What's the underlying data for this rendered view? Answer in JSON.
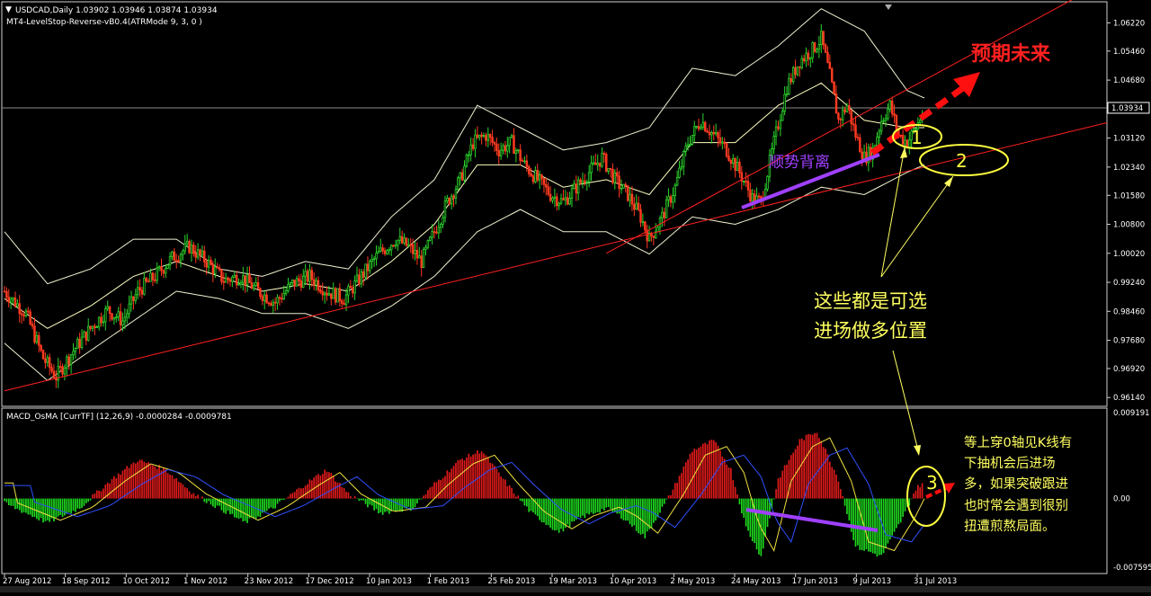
{
  "chart_data": [
    {
      "type": "candlestick",
      "symbol_header": "USDCAD,Daily  1.03902 1.03946 1.03874 1.03934",
      "indicator_header": "MT4-LevelStop-Reverse-vB0.4(ATRMode 9, 3, 0 )",
      "ylim": [
        0.96,
        1.064
      ],
      "y_ticks": [
        "1.06220",
        "1.05460",
        "1.04680",
        "1.03934",
        "1.03120",
        "1.02340",
        "1.01580",
        "1.00800",
        "1.00020",
        "0.99240",
        "0.98460",
        "0.97680",
        "0.96920",
        "0.96140"
      ],
      "last_price": 1.03934,
      "x_tick_labels": [
        "27 Aug 2012",
        "18 Sep 2012",
        "10 Oct 2012",
        "1 Nov 2012",
        "23 Nov 2012",
        "17 Dec 2012",
        "10 Jan 2013",
        "1 Feb 2013",
        "25 Feb 2013",
        "19 Mar 2013",
        "10 Apr 2013",
        "2 May 2013",
        "24 May 2013",
        "17 Jun 2013",
        "9 Jul 2013",
        "31 Jul 2013"
      ],
      "close_path": [
        [
          0,
          0.99
        ],
        [
          10,
          0.984
        ],
        [
          18,
          0.972
        ],
        [
          24,
          0.967
        ],
        [
          32,
          0.974
        ],
        [
          40,
          0.98
        ],
        [
          48,
          0.985
        ],
        [
          55,
          0.982
        ],
        [
          62,
          0.99
        ],
        [
          70,
          0.994
        ],
        [
          78,
          0.999
        ],
        [
          86,
          1.002
        ],
        [
          94,
          0.998
        ],
        [
          102,
          0.993
        ],
        [
          110,
          0.994
        ],
        [
          118,
          0.99
        ],
        [
          126,
          0.987
        ],
        [
          134,
          0.992
        ],
        [
          142,
          0.994
        ],
        [
          150,
          0.99
        ],
        [
          158,
          0.988
        ],
        [
          166,
          0.994
        ],
        [
          174,
          1.0
        ],
        [
          182,
          1.004
        ],
        [
          188,
          1.002
        ],
        [
          194,
          0.998
        ],
        [
          200,
          1.006
        ],
        [
          206,
          1.014
        ],
        [
          212,
          1.02
        ],
        [
          218,
          1.03
        ],
        [
          224,
          1.032
        ],
        [
          230,
          1.028
        ],
        [
          236,
          1.03
        ],
        [
          242,
          1.024
        ],
        [
          248,
          1.02
        ],
        [
          254,
          1.016
        ],
        [
          260,
          1.014
        ],
        [
          266,
          1.018
        ],
        [
          272,
          1.022
        ],
        [
          278,
          1.026
        ],
        [
          284,
          1.02
        ],
        [
          290,
          1.016
        ],
        [
          296,
          1.01
        ],
        [
          300,
          1.004
        ],
        [
          306,
          1.01
        ],
        [
          312,
          1.018
        ],
        [
          318,
          1.03
        ],
        [
          324,
          1.036
        ],
        [
          330,
          1.032
        ],
        [
          336,
          1.028
        ],
        [
          342,
          1.022
        ],
        [
          348,
          1.015
        ],
        [
          352,
          1.014
        ],
        [
          358,
          1.03
        ],
        [
          364,
          1.045
        ],
        [
          370,
          1.052
        ],
        [
          376,
          1.055
        ],
        [
          380,
          1.058
        ],
        [
          384,
          1.048
        ],
        [
          388,
          1.036
        ],
        [
          392,
          1.04
        ],
        [
          396,
          1.032
        ],
        [
          400,
          1.026
        ],
        [
          404,
          1.028
        ],
        [
          408,
          1.036
        ],
        [
          412,
          1.04
        ],
        [
          416,
          1.032
        ],
        [
          420,
          1.03
        ],
        [
          424,
          1.034
        ],
        [
          428,
          1.039
        ]
      ],
      "bollinger": {
        "upper": [
          [
            0,
            1.006
          ],
          [
            20,
            0.992
          ],
          [
            40,
            0.996
          ],
          [
            60,
            1.004
          ],
          [
            80,
            1.004
          ],
          [
            100,
            0.996
          ],
          [
            120,
            0.994
          ],
          [
            140,
            0.998
          ],
          [
            160,
            0.996
          ],
          [
            180,
            1.01
          ],
          [
            200,
            1.02
          ],
          [
            220,
            1.04
          ],
          [
            240,
            1.034
          ],
          [
            260,
            1.028
          ],
          [
            280,
            1.03
          ],
          [
            300,
            1.034
          ],
          [
            320,
            1.05
          ],
          [
            340,
            1.048
          ],
          [
            360,
            1.056
          ],
          [
            380,
            1.066
          ],
          [
            400,
            1.06
          ],
          [
            420,
            1.044
          ],
          [
            428,
            1.042
          ]
        ],
        "middle": [
          [
            0,
            0.988
          ],
          [
            20,
            0.98
          ],
          [
            40,
            0.986
          ],
          [
            60,
            0.994
          ],
          [
            80,
            0.998
          ],
          [
            100,
            0.994
          ],
          [
            120,
            0.99
          ],
          [
            140,
            0.992
          ],
          [
            160,
            0.99
          ],
          [
            180,
            0.998
          ],
          [
            200,
            1.008
          ],
          [
            220,
            1.024
          ],
          [
            240,
            1.024
          ],
          [
            260,
            1.018
          ],
          [
            280,
            1.02
          ],
          [
            300,
            1.016
          ],
          [
            320,
            1.03
          ],
          [
            340,
            1.03
          ],
          [
            360,
            1.04
          ],
          [
            380,
            1.046
          ],
          [
            400,
            1.036
          ],
          [
            420,
            1.034
          ],
          [
            428,
            1.034
          ]
        ],
        "lower": [
          [
            0,
            0.976
          ],
          [
            20,
            0.966
          ],
          [
            40,
            0.974
          ],
          [
            60,
            0.982
          ],
          [
            80,
            0.99
          ],
          [
            100,
            0.988
          ],
          [
            120,
            0.984
          ],
          [
            140,
            0.984
          ],
          [
            160,
            0.98
          ],
          [
            180,
            0.986
          ],
          [
            200,
            0.994
          ],
          [
            220,
            1.006
          ],
          [
            240,
            1.012
          ],
          [
            260,
            1.006
          ],
          [
            280,
            1.006
          ],
          [
            300,
            1.0
          ],
          [
            320,
            1.01
          ],
          [
            340,
            1.008
          ],
          [
            360,
            1.012
          ],
          [
            380,
            1.018
          ],
          [
            400,
            1.016
          ],
          [
            420,
            1.022
          ],
          [
            428,
            1.024
          ]
        ]
      },
      "trendlines": [
        {
          "color": "#ff2020",
          "from": [
            0,
            0.9632
          ],
          "to": [
            428,
            1.0234
          ]
        },
        {
          "color": "#ff2020",
          "from": [
            280,
            1.0002
          ],
          "to": [
            428,
            1.0468
          ]
        }
      ],
      "horizontal_line": 1.03934,
      "annotations": [
        "预期未来",
        "顺势背离",
        "这些都是可选",
        "进场做多位置",
        "1",
        "2"
      ]
    },
    {
      "type": "histogram+line",
      "indicator_header": "MACD_OsMA [CurrTF] (12,26,9) -0.0000284 -0.0009781",
      "ylim": [
        -0.007595,
        0.009191
      ],
      "y_ticks": [
        "0.009191",
        "0.00",
        "-0.007595"
      ],
      "annotations": [
        "等上穿0轴见K线有",
        "下抽机会后进场",
        "多，如果突破跟进",
        "也时常会遇到很别",
        "扭遭煎熬局面。",
        "3"
      ]
    }
  ]
}
